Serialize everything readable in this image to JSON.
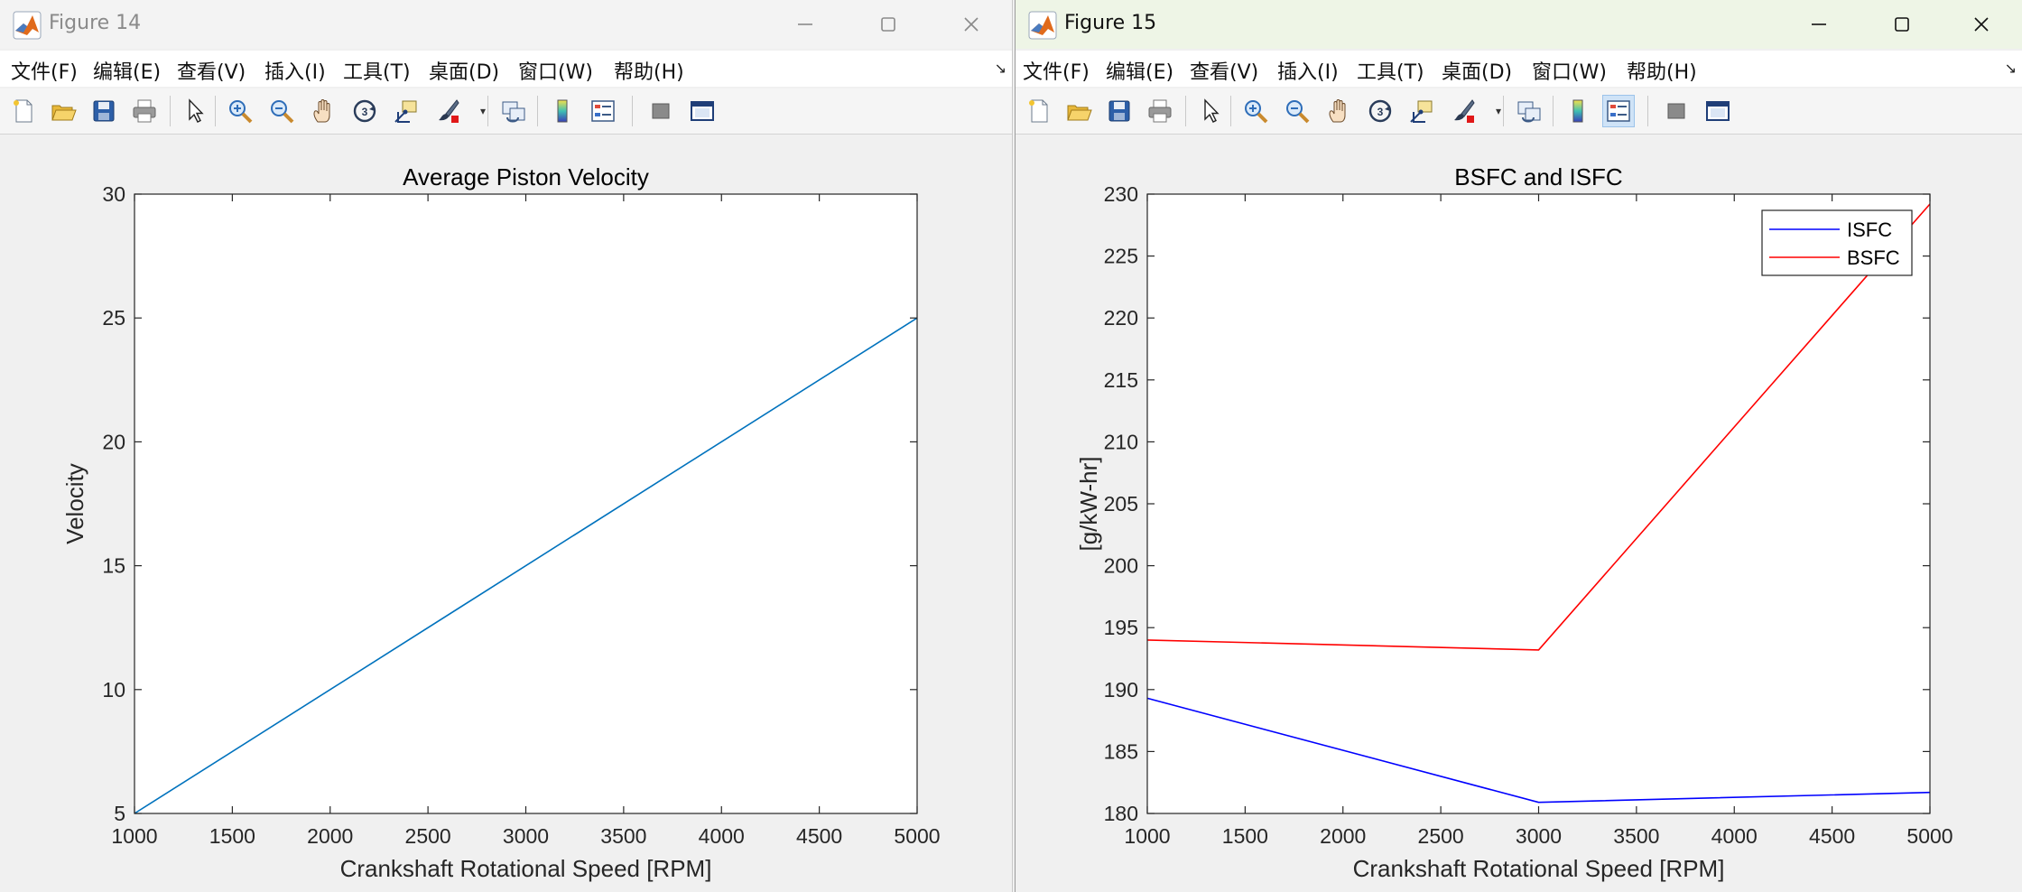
{
  "menus": [
    "文件(F)",
    "编辑(E)",
    "查看(V)",
    "插入(I)",
    "工具(T)",
    "桌面(D)",
    "窗口(W)",
    "帮助(H)"
  ],
  "toolbar_icons": [
    "new-figure-icon",
    "open-file-icon",
    "save-icon",
    "print-icon",
    "select-arrow-icon",
    "zoom-in-icon",
    "zoom-out-icon",
    "pan-hand-icon",
    "rotate-3d-icon",
    "data-cursor-icon",
    "brush-icon",
    "link-plot-icon",
    "insert-colorbar-icon",
    "insert-legend-icon",
    "hide-plot-tools-icon",
    "show-plot-tools-icon"
  ],
  "windows": [
    {
      "title": "Figure 14",
      "chart_data": {
        "type": "line",
        "title": "Average Piston Velocity",
        "xlabel": "Crankshaft Rotational Speed [RPM]",
        "ylabel": "Velocity",
        "xlim": [
          1000,
          5000
        ],
        "ylim": [
          5,
          30
        ],
        "xticks": [
          1000,
          1500,
          2000,
          2500,
          3000,
          3500,
          4000,
          4500,
          5000
        ],
        "yticks": [
          5,
          10,
          15,
          20,
          25,
          30
        ],
        "grid": false,
        "legend": null,
        "series": [
          {
            "color": "#0072bd",
            "x": [
              1000,
              5000
            ],
            "y": [
              5,
              25
            ]
          }
        ]
      }
    },
    {
      "title": "Figure 15",
      "chart_data": {
        "type": "line",
        "title": "BSFC and ISFC",
        "xlabel": "Crankshaft Rotational Speed [RPM]",
        "ylabel": "[g/kW-hr]",
        "xlim": [
          1000,
          5000
        ],
        "ylim": [
          180,
          230
        ],
        "xticks": [
          1000,
          1500,
          2000,
          2500,
          3000,
          3500,
          4000,
          4500,
          5000
        ],
        "yticks": [
          180,
          185,
          190,
          195,
          200,
          205,
          210,
          215,
          220,
          225,
          230
        ],
        "grid": false,
        "legend": "top-right",
        "series": [
          {
            "name": "ISFC",
            "color": "#0000ff",
            "x": [
              1000,
              3000,
              5000
            ],
            "y": [
              189.3,
              180.9,
              181.7
            ]
          },
          {
            "name": "BSFC",
            "color": "#ff0000",
            "x": [
              1000,
              3000,
              5000
            ],
            "y": [
              194.0,
              193.2,
              229.2
            ]
          }
        ]
      }
    }
  ]
}
